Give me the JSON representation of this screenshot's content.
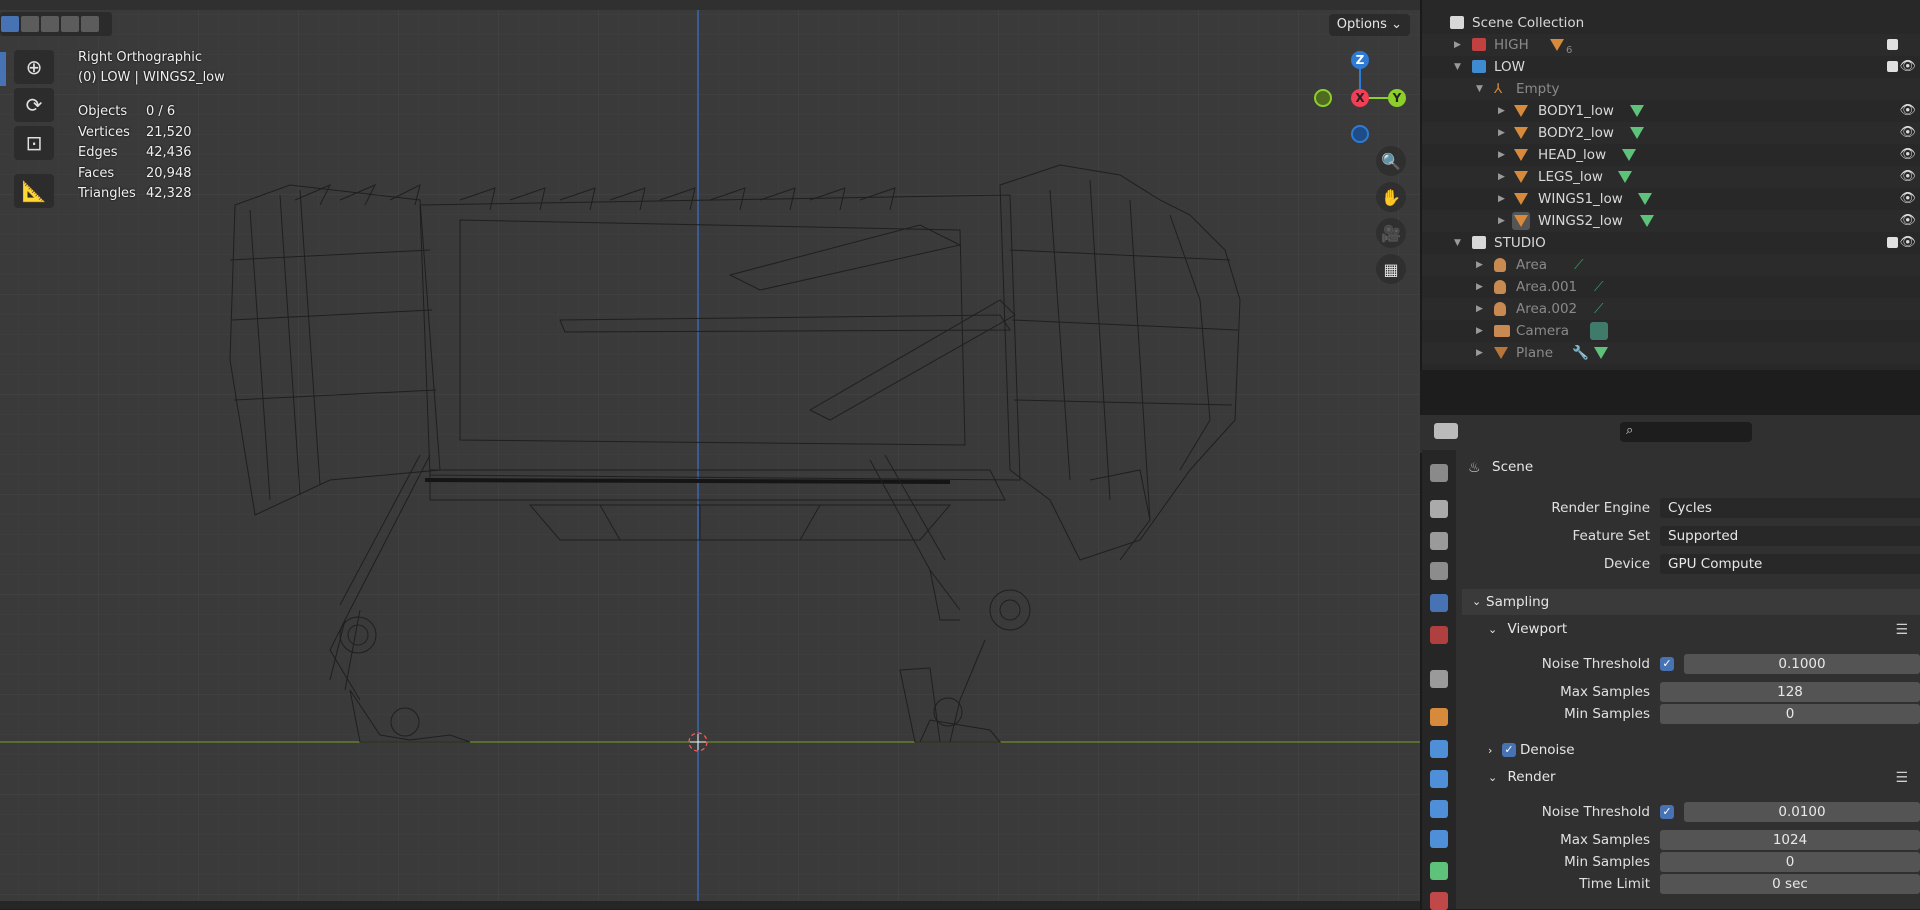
{
  "viewport": {
    "options_label": "Options",
    "view_name": "Right Orthographic",
    "object_info": "(0) LOW | WINGS2_low",
    "stats": [
      {
        "label": "Objects",
        "value": "0 / 6"
      },
      {
        "label": "Vertices",
        "value": "21,520"
      },
      {
        "label": "Edges",
        "value": "42,436"
      },
      {
        "label": "Faces",
        "value": "20,948"
      },
      {
        "label": "Triangles",
        "value": "42,328"
      }
    ],
    "gizmo": {
      "z": "Z",
      "x": "X",
      "y": "Y"
    }
  },
  "outliner": {
    "root": "Scene Collection",
    "rows": [
      {
        "label": "HIGH",
        "badge": "6"
      },
      {
        "label": "LOW"
      },
      {
        "label": "Empty"
      },
      {
        "label": "BODY1_low"
      },
      {
        "label": "BODY2_low"
      },
      {
        "label": "HEAD_low"
      },
      {
        "label": "LEGS_low"
      },
      {
        "label": "WINGS1_low"
      },
      {
        "label": "WINGS2_low"
      },
      {
        "label": "STUDIO"
      },
      {
        "label": "Area"
      },
      {
        "label": "Area.001"
      },
      {
        "label": "Area.002"
      },
      {
        "label": "Camera"
      },
      {
        "label": "Plane"
      }
    ]
  },
  "properties": {
    "context": "Scene",
    "render_engine": {
      "label": "Render Engine",
      "value": "Cycles"
    },
    "feature_set": {
      "label": "Feature Set",
      "value": "Supported"
    },
    "device": {
      "label": "Device",
      "value": "GPU Compute"
    },
    "sampling": {
      "label": "Sampling",
      "viewport": {
        "label": "Viewport",
        "noise_threshold": {
          "label": "Noise Threshold",
          "value": "0.1000"
        },
        "max_samples": {
          "label": "Max Samples",
          "value": "128"
        },
        "min_samples": {
          "label": "Min Samples",
          "value": "0"
        }
      },
      "denoise": {
        "label": "Denoise"
      },
      "render": {
        "label": "Render",
        "noise_threshold": {
          "label": "Noise Threshold",
          "value": "0.0100"
        },
        "max_samples": {
          "label": "Max Samples",
          "value": "1024"
        },
        "min_samples": {
          "label": "Min Samples",
          "value": "0"
        },
        "time_limit": {
          "label": "Time Limit",
          "value": "0 sec"
        }
      }
    }
  },
  "colors": {
    "accent": "#4772b3",
    "axis_x": "#f23f56",
    "axis_y": "#8ccf2a",
    "axis_z": "#2e7bd6",
    "mesh": "#d78a3b"
  }
}
